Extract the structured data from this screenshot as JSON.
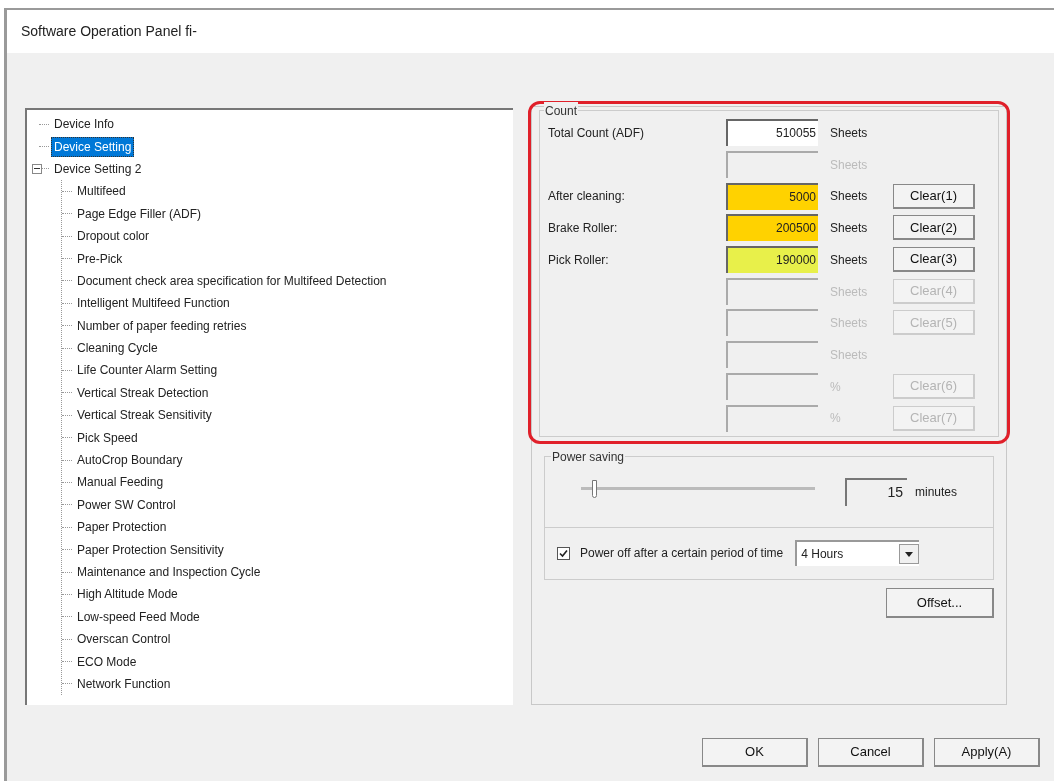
{
  "window": {
    "title": "Software Operation Panel fi-"
  },
  "tree": [
    {
      "label": "Device Info",
      "selected": false
    },
    {
      "label": "Device Setting",
      "selected": true
    },
    {
      "label": "Device Setting 2",
      "selected": false,
      "expanded": true,
      "children": [
        {
          "label": "Multifeed",
          "selected": false
        },
        {
          "label": "Page Edge Filler (ADF)",
          "selected": false
        },
        {
          "label": "Dropout color",
          "selected": false
        },
        {
          "label": "Pre-Pick",
          "selected": false
        },
        {
          "label": "Document check area specification for Multifeed Detection",
          "selected": false
        },
        {
          "label": "Intelligent Multifeed Function",
          "selected": false
        },
        {
          "label": "Number of paper feeding retries",
          "selected": false
        },
        {
          "label": "Cleaning Cycle",
          "selected": false
        },
        {
          "label": "Life Counter Alarm Setting",
          "selected": false
        },
        {
          "label": "Vertical Streak Detection",
          "selected": false
        },
        {
          "label": "Vertical Streak Sensitivity",
          "selected": false
        },
        {
          "label": "Pick Speed",
          "selected": false
        },
        {
          "label": "AutoCrop Boundary",
          "selected": false
        },
        {
          "label": "Manual Feeding",
          "selected": false
        },
        {
          "label": "Power SW Control",
          "selected": false
        },
        {
          "label": "Paper Protection",
          "selected": false
        },
        {
          "label": "Paper Protection Sensitivity",
          "selected": false
        },
        {
          "label": "Maintenance and Inspection Cycle",
          "selected": false
        },
        {
          "label": "High Altitude Mode",
          "selected": false
        },
        {
          "label": "Low-speed Feed Mode",
          "selected": false
        },
        {
          "label": "Overscan Control",
          "selected": false
        },
        {
          "label": "ECO Mode",
          "selected": false
        },
        {
          "label": "Network Function",
          "selected": false
        }
      ]
    }
  ],
  "count": {
    "title": "Count",
    "rows": [
      {
        "label": "Total Count (ADF)",
        "value": "510055",
        "color": "#ffffff",
        "unit": "Sheets",
        "disabled": false
      },
      {
        "value": "",
        "color": "#f0f0f0",
        "unit": "Sheets",
        "disabled": true
      },
      {
        "label": "After cleaning:",
        "value": "5000",
        "color": "#ffd200",
        "unit": "Sheets",
        "disabled": false,
        "button": "Clear(1)"
      },
      {
        "label": "Brake Roller:",
        "value": "200500",
        "color": "#ffd200",
        "unit": "Sheets",
        "disabled": false,
        "button": "Clear(2)"
      },
      {
        "label": "Pick Roller:",
        "value": "190000",
        "color": "#e8f04a",
        "unit": "Sheets",
        "disabled": false,
        "button": "Clear(3)"
      },
      {
        "value": "",
        "color": "#f0f0f0",
        "unit": "Sheets",
        "disabled": true,
        "button": "Clear(4)"
      },
      {
        "value": "",
        "color": "#f0f0f0",
        "unit": "Sheets",
        "disabled": true,
        "button": "Clear(5)"
      },
      {
        "value": "",
        "color": "#f0f0f0",
        "unit": "Sheets",
        "disabled": true
      },
      {
        "value": "",
        "color": "#f0f0f0",
        "unit": "%",
        "disabled": true,
        "button": "Clear(6)"
      },
      {
        "value": "",
        "color": "#f0f0f0",
        "unit": "%",
        "disabled": true,
        "button": "Clear(7)"
      }
    ]
  },
  "power_saving": {
    "title": "Power saving",
    "level": 0.05,
    "value": "15",
    "unit": "minutes"
  },
  "power_off": {
    "checked": true,
    "label": "Power off after a certain period of time",
    "value": "4 Hours"
  },
  "offset_button": "Offset...",
  "buttons": [
    "OK",
    "Cancel",
    "Apply(A)"
  ]
}
